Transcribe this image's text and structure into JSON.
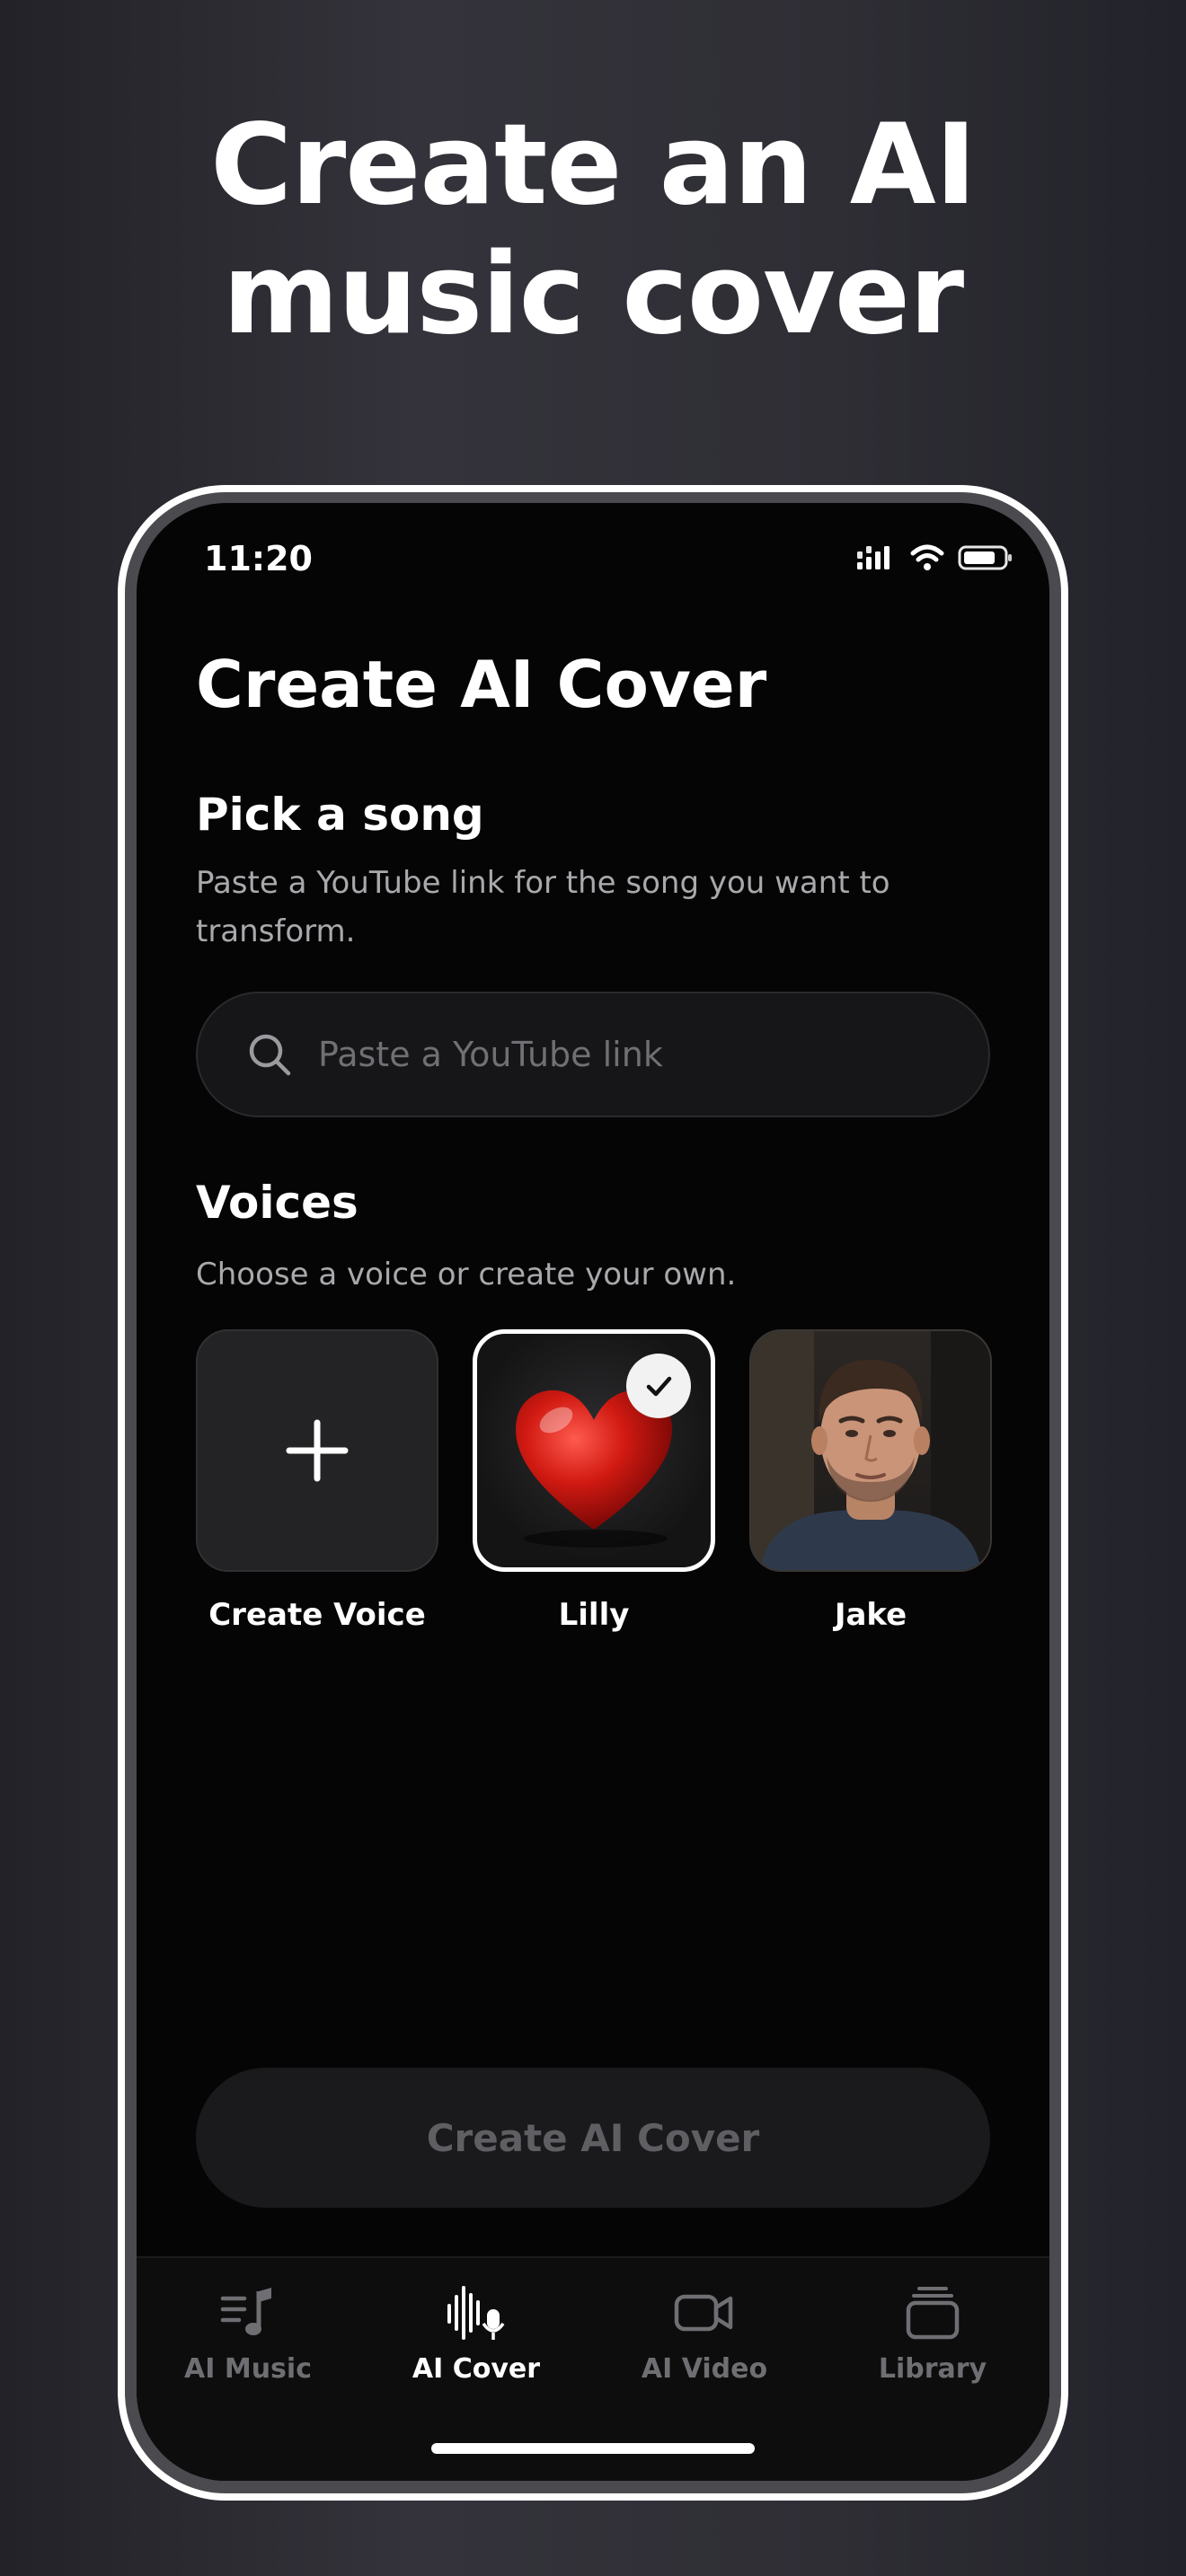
{
  "headline": "Create an AI\nmusic cover",
  "status_bar": {
    "time": "11:20"
  },
  "screen": {
    "title": "Create AI Cover",
    "pick_song": {
      "title": "Pick a song",
      "description": "Paste a YouTube link for the song you want to transform.",
      "search_placeholder": "Paste a YouTube link"
    },
    "voices": {
      "title": "Voices",
      "description": "Choose a voice or create your own.",
      "items": [
        {
          "label": "Create Voice",
          "icon": "plus-icon",
          "selected": false
        },
        {
          "label": "Lilly",
          "icon": "red-heart-image",
          "selected": true
        },
        {
          "label": "Jake",
          "icon": "man-portrait-image",
          "selected": false
        }
      ]
    },
    "create_button": "Create AI Cover"
  },
  "tabbar": {
    "tabs": [
      {
        "label": "AI Music",
        "icon": "music-note-icon",
        "active": false
      },
      {
        "label": "AI Cover",
        "icon": "waveform-mic-icon",
        "active": true
      },
      {
        "label": "AI Video",
        "icon": "video-camera-icon",
        "active": false
      },
      {
        "label": "Library",
        "icon": "library-stack-icon",
        "active": false
      }
    ]
  },
  "colors": {
    "background": "#050505",
    "accent": "#ffffff",
    "muted_text": "#a9a9ad",
    "inactive_tab": "#6e6e73"
  }
}
